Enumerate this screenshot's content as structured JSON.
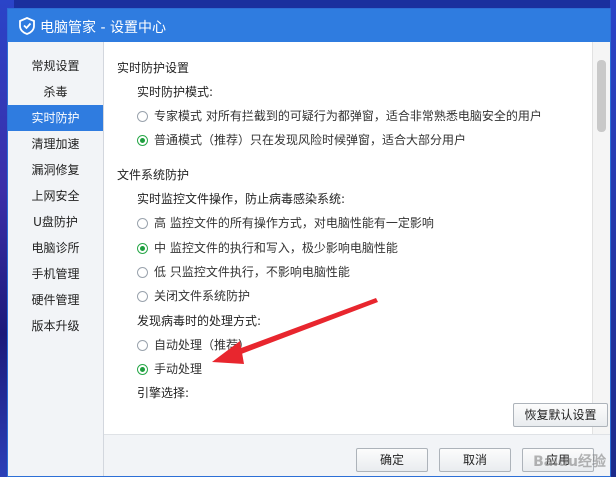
{
  "app": {
    "title": "电脑管家 - 设置中心"
  },
  "sidebar": {
    "items": [
      {
        "label": "常规设置"
      },
      {
        "label": "杀毒"
      },
      {
        "label": "实时防护"
      },
      {
        "label": "清理加速"
      },
      {
        "label": "漏洞修复"
      },
      {
        "label": "上网安全"
      },
      {
        "label": "U盘防护"
      },
      {
        "label": "电脑诊所"
      },
      {
        "label": "手机管理"
      },
      {
        "label": "硬件管理"
      },
      {
        "label": "版本升级"
      }
    ],
    "active_index": 2
  },
  "realtime": {
    "title": "实时防护设置",
    "mode_label": "实时防护模式:",
    "options": [
      {
        "label": "专家模式  对所有拦截到的可疑行为都弹窗，适合非常熟悉电脑安全的用户",
        "checked": false
      },
      {
        "label": "普通模式（推荐）只在发现风险时候弹窗，适合大部分用户",
        "checked": true
      }
    ]
  },
  "filesystem": {
    "title": "文件系统防护",
    "monitor_label": "实时监控文件操作，防止病毒感染系统:",
    "options": [
      {
        "label": "高   监控文件的所有操作方式，对电脑性能有一定影响",
        "checked": false
      },
      {
        "label": "中   监控文件的执行和写入，极少影响电脑性能",
        "checked": true
      },
      {
        "label": "低   只监控文件执行，不影响电脑性能",
        "checked": false
      },
      {
        "label": "关闭文件系统防护",
        "checked": false
      }
    ],
    "virus_label": "发现病毒时的处理方式:",
    "virus_options": [
      {
        "label": "自动处理（推荐）",
        "checked": false
      },
      {
        "label": "手动处理",
        "checked": true
      }
    ],
    "engine_label": "引擎选择:"
  },
  "buttons": {
    "restore": "恢复默认设置",
    "ok": "确定",
    "cancel": "取消",
    "apply": "应用"
  },
  "colors": {
    "accent": "#2f7ce0",
    "radio_checked": "#1e9e3e",
    "annotation_arrow": "#e8262e"
  },
  "watermark": "Baidu经验"
}
